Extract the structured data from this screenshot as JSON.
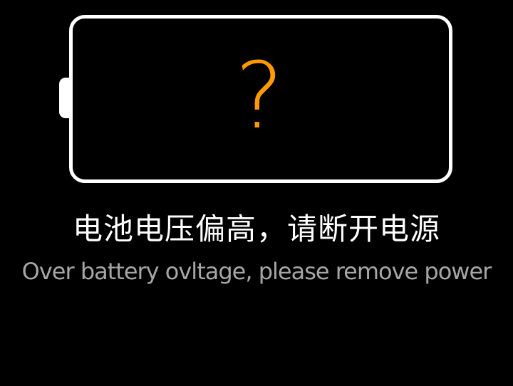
{
  "colors": {
    "background": "#000000",
    "battery_outline": "#ffffff",
    "question_mark": "#ff9a00",
    "message_zh": "#ffffff",
    "message_en": "#a6a6a6"
  },
  "battery": {
    "icon": "battery-outline-icon",
    "status_symbol": "?"
  },
  "message": {
    "zh": "电池电压偏高，请断开电源",
    "en": "Over battery ovltage, please remove power"
  }
}
